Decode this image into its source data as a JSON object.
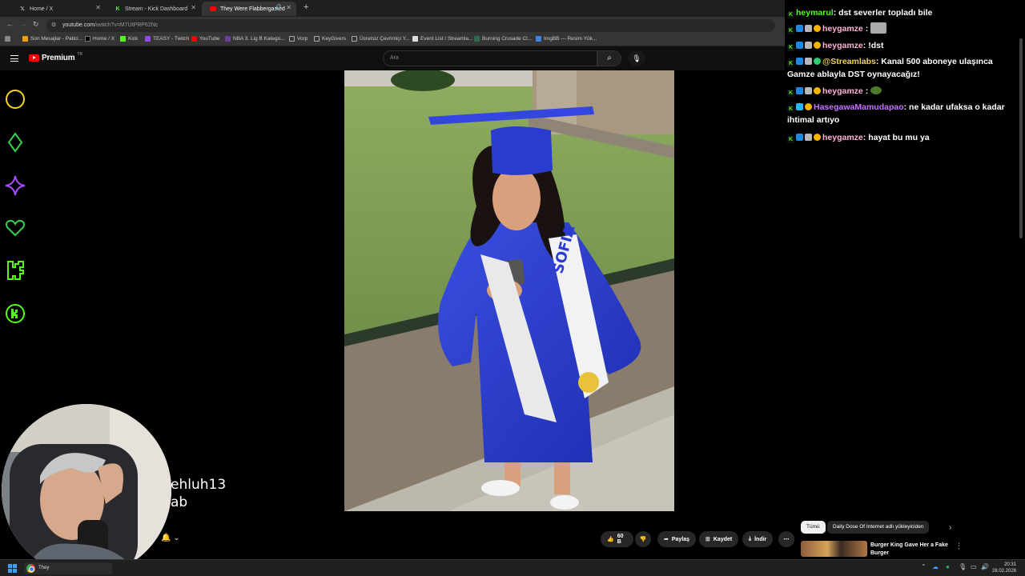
{
  "browser": {
    "tabs": [
      {
        "label": "Home / X",
        "icon": "x-logo-icon"
      },
      {
        "label": "Stream - Kick Dashboard",
        "icon": "kick-logo-icon"
      },
      {
        "label": "They Were Flabbergasted",
        "icon": "youtube-logo-icon"
      }
    ],
    "url_host": "youtube.com",
    "url_path": "/watch?v=M7UtPRP62Nc",
    "bookmarks": [
      "Son Mesajlar - Patici...",
      "Home / X",
      "Kick",
      "TEASY - Twitch",
      "YouTube",
      "NBA 3. Lig B Katego...",
      "Vorp",
      "KeyGivers",
      "Ücretsiz Çevrimiçi Y...",
      "Event List / Streamla...",
      "Burning Crusade Cl...",
      "ImgBB — Resim Yük..."
    ]
  },
  "youtube": {
    "brand": "Premium",
    "region": "TR",
    "search_placeholder": "Ara",
    "actions": {
      "like_count": "60 B",
      "share": "Paylaş",
      "save": "Kaydet",
      "download": "İndir"
    },
    "chips": [
      "Tümü",
      "Daily Dose Of Internet adlı yükleyiciden"
    ],
    "recommendation": {
      "title": "Burger King Gave Her a Fake Burger"
    }
  },
  "overlay": {
    "side_icons": [
      "circle-icon",
      "diamond-icon",
      "sparkle-icon",
      "heart-icon",
      "kick-k-icon",
      "kick-circle-icon"
    ],
    "cam_text": [
      "ehluh13",
      "ab"
    ]
  },
  "chat": {
    "messages": [
      {
        "user": "heymarul",
        "text": ": dst severler topladı bile"
      },
      {
        "user": "heygamze",
        "text": " :"
      },
      {
        "user": "heygamze",
        "text": ": !dst"
      },
      {
        "user": "@Streamlabs",
        "text": ": Kanal 500 aboneye ulaşınca Gamze ablayla DST oynayacağız!"
      },
      {
        "user": "heygamze",
        "text": " :"
      },
      {
        "user": "HasegawaMamudapao",
        "text": ": ne kadar ufaksa o kadar ihtimal artıyo"
      },
      {
        "user": "heygamze",
        "text": ": hayat bu mu ya"
      }
    ]
  },
  "taskbar": {
    "app_label": "They",
    "time": "20:31",
    "date": "28.02.2026"
  },
  "colors": {
    "kick_green": "#53fc18",
    "youtube_red": "#ff0000",
    "gown_blue": "#2c3fd6"
  }
}
